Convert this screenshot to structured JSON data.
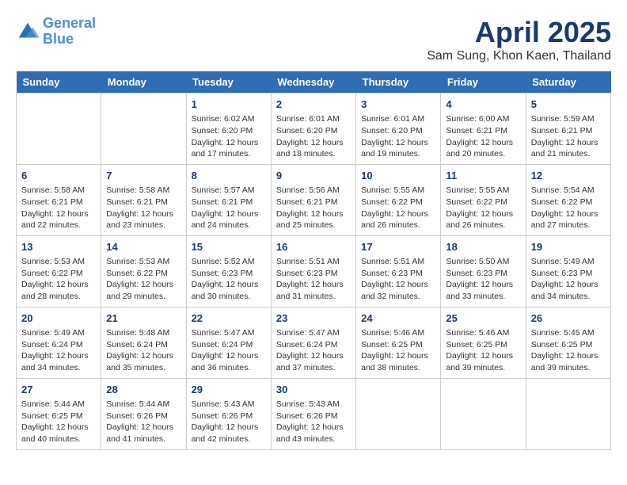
{
  "header": {
    "logo_line1": "General",
    "logo_line2": "Blue",
    "month_title": "April 2025",
    "location": "Sam Sung, Khon Kaen, Thailand"
  },
  "days": [
    "Sunday",
    "Monday",
    "Tuesday",
    "Wednesday",
    "Thursday",
    "Friday",
    "Saturday"
  ],
  "weeks": [
    [
      {
        "date": "",
        "sunrise": "",
        "sunset": "",
        "daylight": ""
      },
      {
        "date": "",
        "sunrise": "",
        "sunset": "",
        "daylight": ""
      },
      {
        "date": "1",
        "sunrise": "Sunrise: 6:02 AM",
        "sunset": "Sunset: 6:20 PM",
        "daylight": "Daylight: 12 hours and 17 minutes."
      },
      {
        "date": "2",
        "sunrise": "Sunrise: 6:01 AM",
        "sunset": "Sunset: 6:20 PM",
        "daylight": "Daylight: 12 hours and 18 minutes."
      },
      {
        "date": "3",
        "sunrise": "Sunrise: 6:01 AM",
        "sunset": "Sunset: 6:20 PM",
        "daylight": "Daylight: 12 hours and 19 minutes."
      },
      {
        "date": "4",
        "sunrise": "Sunrise: 6:00 AM",
        "sunset": "Sunset: 6:21 PM",
        "daylight": "Daylight: 12 hours and 20 minutes."
      },
      {
        "date": "5",
        "sunrise": "Sunrise: 5:59 AM",
        "sunset": "Sunset: 6:21 PM",
        "daylight": "Daylight: 12 hours and 21 minutes."
      }
    ],
    [
      {
        "date": "6",
        "sunrise": "Sunrise: 5:58 AM",
        "sunset": "Sunset: 6:21 PM",
        "daylight": "Daylight: 12 hours and 22 minutes."
      },
      {
        "date": "7",
        "sunrise": "Sunrise: 5:58 AM",
        "sunset": "Sunset: 6:21 PM",
        "daylight": "Daylight: 12 hours and 23 minutes."
      },
      {
        "date": "8",
        "sunrise": "Sunrise: 5:57 AM",
        "sunset": "Sunset: 6:21 PM",
        "daylight": "Daylight: 12 hours and 24 minutes."
      },
      {
        "date": "9",
        "sunrise": "Sunrise: 5:56 AM",
        "sunset": "Sunset: 6:21 PM",
        "daylight": "Daylight: 12 hours and 25 minutes."
      },
      {
        "date": "10",
        "sunrise": "Sunrise: 5:55 AM",
        "sunset": "Sunset: 6:22 PM",
        "daylight": "Daylight: 12 hours and 26 minutes."
      },
      {
        "date": "11",
        "sunrise": "Sunrise: 5:55 AM",
        "sunset": "Sunset: 6:22 PM",
        "daylight": "Daylight: 12 hours and 26 minutes."
      },
      {
        "date": "12",
        "sunrise": "Sunrise: 5:54 AM",
        "sunset": "Sunset: 6:22 PM",
        "daylight": "Daylight: 12 hours and 27 minutes."
      }
    ],
    [
      {
        "date": "13",
        "sunrise": "Sunrise: 5:53 AM",
        "sunset": "Sunset: 6:22 PM",
        "daylight": "Daylight: 12 hours and 28 minutes."
      },
      {
        "date": "14",
        "sunrise": "Sunrise: 5:53 AM",
        "sunset": "Sunset: 6:22 PM",
        "daylight": "Daylight: 12 hours and 29 minutes."
      },
      {
        "date": "15",
        "sunrise": "Sunrise: 5:52 AM",
        "sunset": "Sunset: 6:23 PM",
        "daylight": "Daylight: 12 hours and 30 minutes."
      },
      {
        "date": "16",
        "sunrise": "Sunrise: 5:51 AM",
        "sunset": "Sunset: 6:23 PM",
        "daylight": "Daylight: 12 hours and 31 minutes."
      },
      {
        "date": "17",
        "sunrise": "Sunrise: 5:51 AM",
        "sunset": "Sunset: 6:23 PM",
        "daylight": "Daylight: 12 hours and 32 minutes."
      },
      {
        "date": "18",
        "sunrise": "Sunrise: 5:50 AM",
        "sunset": "Sunset: 6:23 PM",
        "daylight": "Daylight: 12 hours and 33 minutes."
      },
      {
        "date": "19",
        "sunrise": "Sunrise: 5:49 AM",
        "sunset": "Sunset: 6:23 PM",
        "daylight": "Daylight: 12 hours and 34 minutes."
      }
    ],
    [
      {
        "date": "20",
        "sunrise": "Sunrise: 5:49 AM",
        "sunset": "Sunset: 6:24 PM",
        "daylight": "Daylight: 12 hours and 34 minutes."
      },
      {
        "date": "21",
        "sunrise": "Sunrise: 5:48 AM",
        "sunset": "Sunset: 6:24 PM",
        "daylight": "Daylight: 12 hours and 35 minutes."
      },
      {
        "date": "22",
        "sunrise": "Sunrise: 5:47 AM",
        "sunset": "Sunset: 6:24 PM",
        "daylight": "Daylight: 12 hours and 36 minutes."
      },
      {
        "date": "23",
        "sunrise": "Sunrise: 5:47 AM",
        "sunset": "Sunset: 6:24 PM",
        "daylight": "Daylight: 12 hours and 37 minutes."
      },
      {
        "date": "24",
        "sunrise": "Sunrise: 5:46 AM",
        "sunset": "Sunset: 6:25 PM",
        "daylight": "Daylight: 12 hours and 38 minutes."
      },
      {
        "date": "25",
        "sunrise": "Sunrise: 5:46 AM",
        "sunset": "Sunset: 6:25 PM",
        "daylight": "Daylight: 12 hours and 39 minutes."
      },
      {
        "date": "26",
        "sunrise": "Sunrise: 5:45 AM",
        "sunset": "Sunset: 6:25 PM",
        "daylight": "Daylight: 12 hours and 39 minutes."
      }
    ],
    [
      {
        "date": "27",
        "sunrise": "Sunrise: 5:44 AM",
        "sunset": "Sunset: 6:25 PM",
        "daylight": "Daylight: 12 hours and 40 minutes."
      },
      {
        "date": "28",
        "sunrise": "Sunrise: 5:44 AM",
        "sunset": "Sunset: 6:26 PM",
        "daylight": "Daylight: 12 hours and 41 minutes."
      },
      {
        "date": "29",
        "sunrise": "Sunrise: 5:43 AM",
        "sunset": "Sunset: 6:26 PM",
        "daylight": "Daylight: 12 hours and 42 minutes."
      },
      {
        "date": "30",
        "sunrise": "Sunrise: 5:43 AM",
        "sunset": "Sunset: 6:26 PM",
        "daylight": "Daylight: 12 hours and 43 minutes."
      },
      {
        "date": "",
        "sunrise": "",
        "sunset": "",
        "daylight": ""
      },
      {
        "date": "",
        "sunrise": "",
        "sunset": "",
        "daylight": ""
      },
      {
        "date": "",
        "sunrise": "",
        "sunset": "",
        "daylight": ""
      }
    ]
  ]
}
